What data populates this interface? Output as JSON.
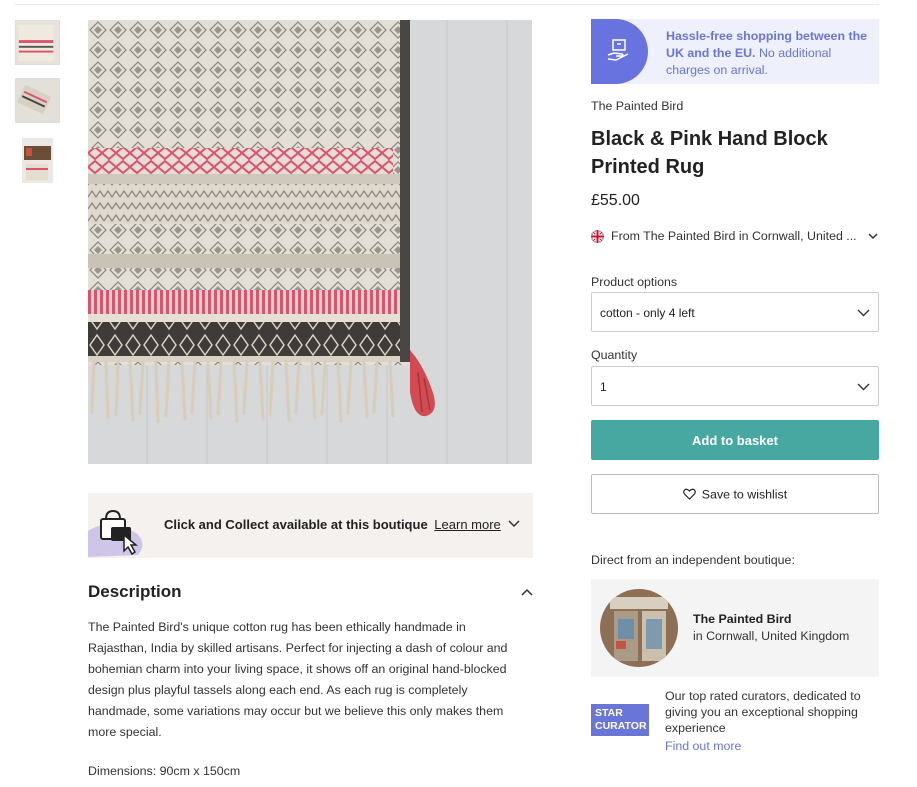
{
  "gallery": {
    "thumbnails": [
      "rug-detail",
      "rug-folded",
      "rug-room"
    ],
    "main_image": "rug-corner-with-tassel"
  },
  "click_collect": {
    "text": "Click and Collect available at this boutique",
    "link": "Learn more"
  },
  "description": {
    "heading": "Description",
    "body": "The Painted Bird's unique cotton rug has been ethically handmade in Rajasthan, India by skilled artisans. Perfect for injecting a dash of colour and bohemian charm into your living space, it shows off an original hand-blocked design plus playful tassels along each end. As each rug is completely handmade, some variations may occur but we believe this only makes them more special.",
    "dimensions": "Dimensions: 90cm x 150cm"
  },
  "banner": {
    "strong": "Hassle-free shopping between the UK and the EU.",
    "rest": " No additional charges on arrival."
  },
  "product": {
    "brand": "The Painted Bird",
    "title": "Black & Pink Hand Block Printed Rug",
    "price": "£55.00",
    "origin": "From The Painted Bird in Cornwall, United ..."
  },
  "options": {
    "label": "Product options",
    "selected": "cotton - only 4 left"
  },
  "quantity": {
    "label": "Quantity",
    "selected": "1"
  },
  "actions": {
    "add_to_basket": "Add to basket",
    "save_to_wishlist": "Save to wishlist"
  },
  "boutique": {
    "intro": "Direct from an independent boutique:",
    "name": "The Painted Bird",
    "location": "in Cornwall, United Kingdom"
  },
  "curator": {
    "badge_line1": "STAR",
    "badge_line2": "CURATOR",
    "text": "Our top rated curators, dedicated to giving you an exceptional shopping experience",
    "link": "Find out more"
  },
  "colors": {
    "accent": "#46a8a1",
    "brand": "#6a75d8",
    "rug_pink": "#d9546e"
  }
}
